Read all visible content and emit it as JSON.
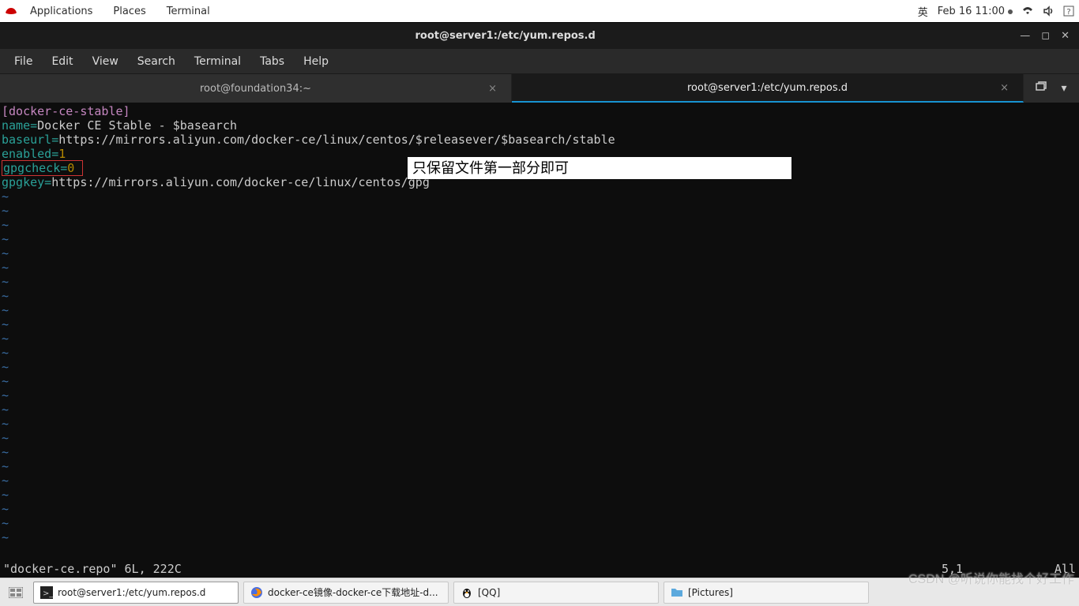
{
  "top_panel": {
    "menus": [
      "Applications",
      "Places",
      "Terminal"
    ],
    "lang": "英",
    "datetime": "Feb 16  11:00"
  },
  "window": {
    "title": "root@server1:/etc/yum.repos.d"
  },
  "menubar": [
    "File",
    "Edit",
    "View",
    "Search",
    "Terminal",
    "Tabs",
    "Help"
  ],
  "tabs": [
    {
      "label": "root@foundation34:~",
      "active": false
    },
    {
      "label": "root@server1:/etc/yum.repos.d",
      "active": true
    }
  ],
  "editor": {
    "section": "[docker-ce-stable]",
    "name_key": "name=",
    "name_val": "Docker CE Stable - $basearch",
    "baseurl_key": "baseurl=",
    "baseurl_val": "https://mirrors.aliyun.com/docker-ce/linux/centos/$releasever/$basearch/stable",
    "enabled_key": "enabled=",
    "enabled_val": "1",
    "gpgcheck_key": "gpgcheck=",
    "gpgcheck_val": "0",
    "gpgkey_key": "gpgkey=",
    "gpgkey_val": "https://mirrors.aliyun.com/docker-ce/linux/centos/gpg",
    "tilde": "~"
  },
  "annotation": "只保留文件第一部分即可",
  "statusline": {
    "fileinfo": "\"docker-ce.repo\" 6L, 222C",
    "cursor": "5,1",
    "pct": "All"
  },
  "taskbar": {
    "items": [
      {
        "label": "root@server1:/etc/yum.repos.d",
        "icon": "terminal"
      },
      {
        "label": "docker-ce镜像-docker-ce下载地址-d...",
        "icon": "firefox"
      },
      {
        "label": "[QQ]",
        "icon": "penguin"
      },
      {
        "label": "[Pictures]",
        "icon": "folder"
      }
    ]
  },
  "watermark": "CSDN @听说你能找个好工作"
}
